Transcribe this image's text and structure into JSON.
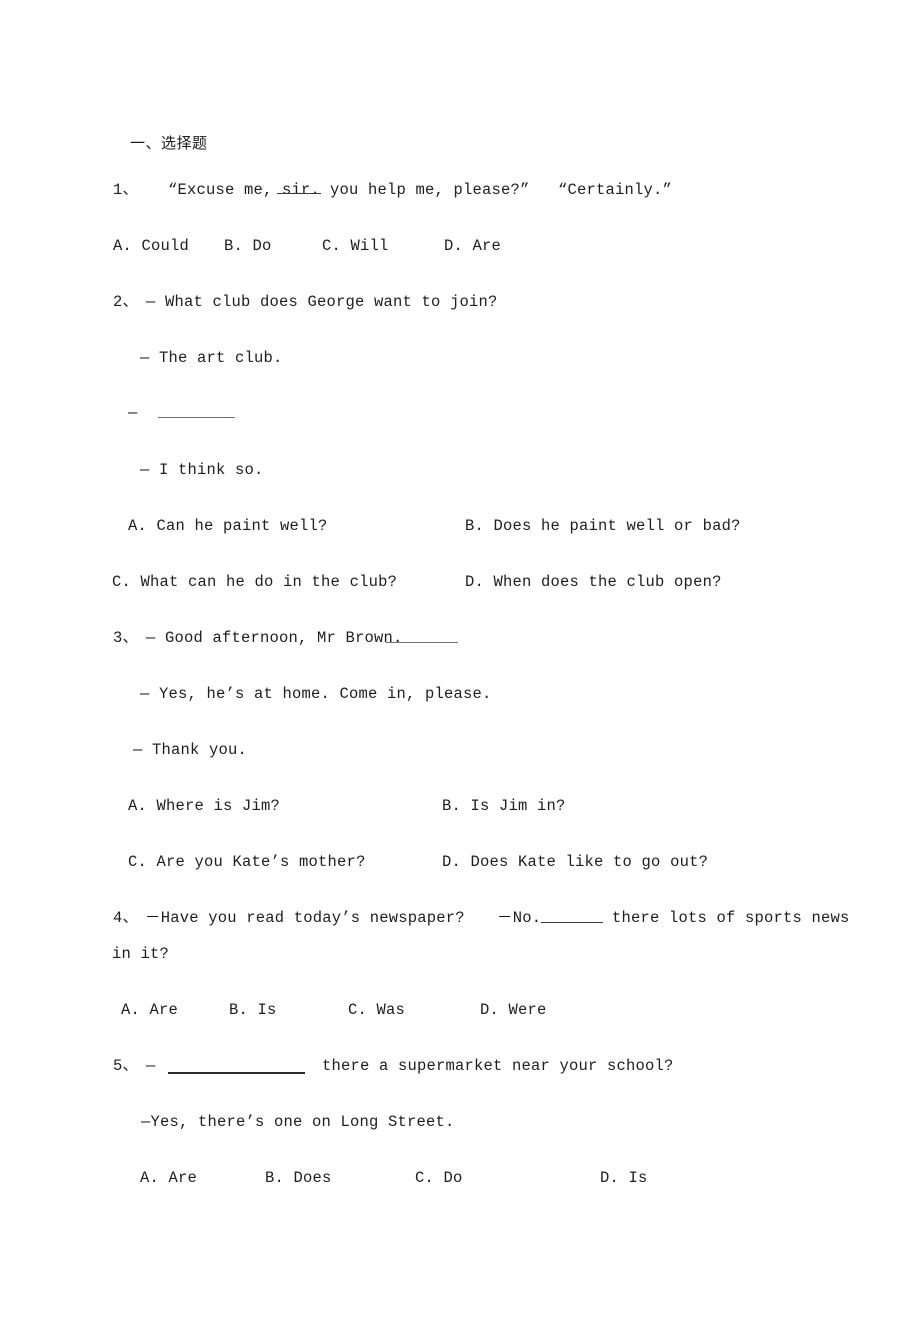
{
  "document": {
    "section_heading": "一、选择题",
    "background_color": "#ffffff",
    "text_color": "#1e1e1e",
    "blank_gray_color": "#6d6470",
    "blank_dark_color": "#2b2b2b"
  },
  "questions": [
    {
      "number": "1、",
      "stem_before_blank": "“Excuse me, sir.",
      "stem_after_blank": "you help me, please?”   “Certainly.”",
      "options": [
        {
          "label": "A.",
          "text": "Could"
        },
        {
          "label": "B.",
          "text": "Do"
        },
        {
          "label": "C.",
          "text": "Will"
        },
        {
          "label": "D.",
          "text": "Are"
        }
      ]
    },
    {
      "number": "2、",
      "dialogue": [
        "— What club does George want to join?",
        "— The art club.",
        "—",
        "— I think so."
      ],
      "options": [
        {
          "label": "A.",
          "text": "Can he paint well?"
        },
        {
          "label": "B.",
          "text": "Does he paint well or bad?"
        },
        {
          "label": "C.",
          "text": "What can he do in the club?"
        },
        {
          "label": "D.",
          "text": "When does the club open?"
        }
      ]
    },
    {
      "number": "3、",
      "dialogue": [
        "— Good afternoon, Mr Brown.",
        "— Yes, he’s at home. Come in, please.",
        "— Thank you."
      ],
      "options": [
        {
          "label": "A.",
          "text": "Where is Jim?"
        },
        {
          "label": "B.",
          "text": "Is Jim in?"
        },
        {
          "label": "C.",
          "text": "Are you Kate’s mother?"
        },
        {
          "label": "D.",
          "text": "Does Kate like to go out?"
        }
      ]
    },
    {
      "number": "4、",
      "stem_line1_a": "－Have you read today’s newspaper?",
      "stem_line1_b": "－No.",
      "stem_line1_c": "there lots of sports news",
      "stem_line2": "in it?",
      "options": [
        {
          "label": "A.",
          "text": "Are"
        },
        {
          "label": "B.",
          "text": "Is"
        },
        {
          "label": "C.",
          "text": "Was"
        },
        {
          "label": "D.",
          "text": "Were"
        }
      ]
    },
    {
      "number": "5、",
      "stem_dash": "—",
      "stem_after_blank": "there a supermarket near your school?",
      "answer_line": "—Yes, there’s one on Long Street.",
      "options": [
        {
          "label": "A.",
          "text": "Are"
        },
        {
          "label": "B.",
          "text": "Does"
        },
        {
          "label": "C.",
          "text": "Do"
        },
        {
          "label": "D.",
          "text": "Is"
        }
      ]
    }
  ]
}
